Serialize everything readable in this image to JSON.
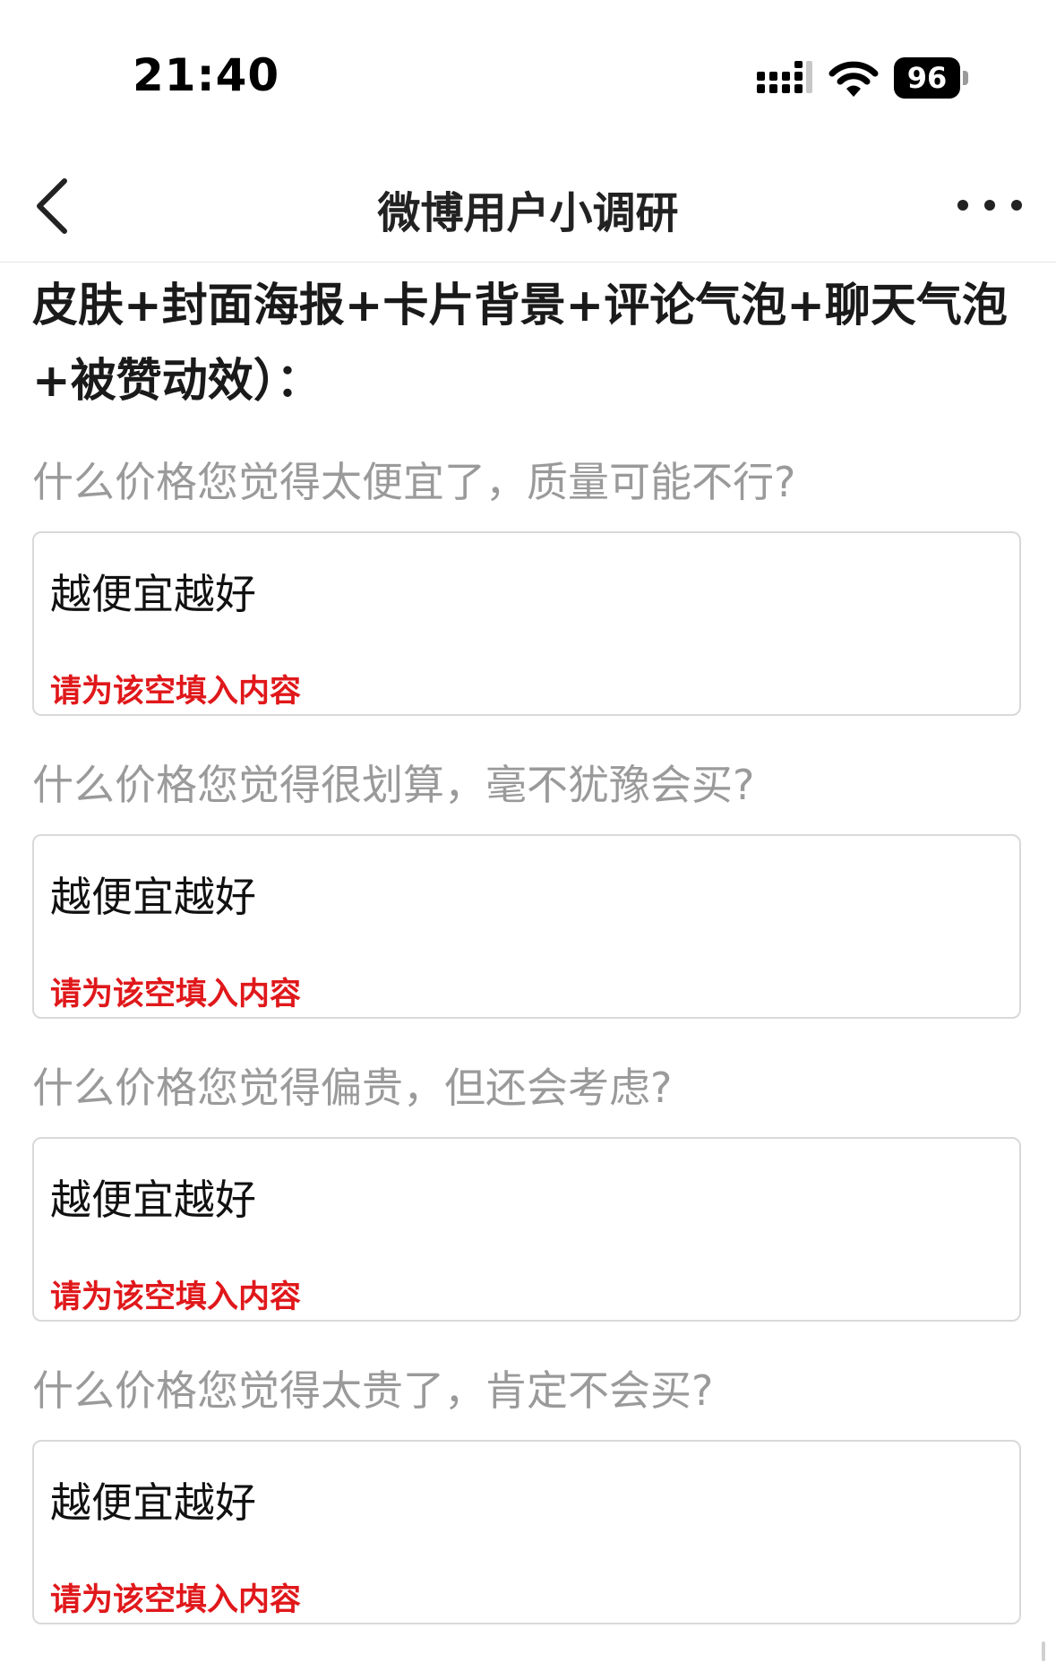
{
  "status_bar": {
    "time": "21:40",
    "battery_level": "96"
  },
  "nav": {
    "title": "微博用户小调研",
    "back_icon": "chevron-left-icon",
    "more_icon": "more-dots-icon"
  },
  "intro": {
    "line1": "皮肤+封面海报+卡片背景+评论气泡+聊天气泡",
    "line2": "+被赞动效）："
  },
  "questions": [
    {
      "label": "什么价格您觉得太便宜了，质量可能不行?",
      "answer": "越便宜越好",
      "error": "请为该空填入内容"
    },
    {
      "label": "什么价格您觉得很划算，毫不犹豫会买?",
      "answer": "越便宜越好",
      "error": "请为该空填入内容"
    },
    {
      "label": "什么价格您觉得偏贵，但还会考虑?",
      "answer": "越便宜越好",
      "error": "请为该空填入内容"
    },
    {
      "label": "什么价格您觉得太贵了，肯定不会买?",
      "answer": "越便宜越好",
      "error": "请为该空填入内容"
    }
  ],
  "colors": {
    "error": "#e0181b",
    "question": "#9a9a9a",
    "border": "#d9d9d9"
  }
}
